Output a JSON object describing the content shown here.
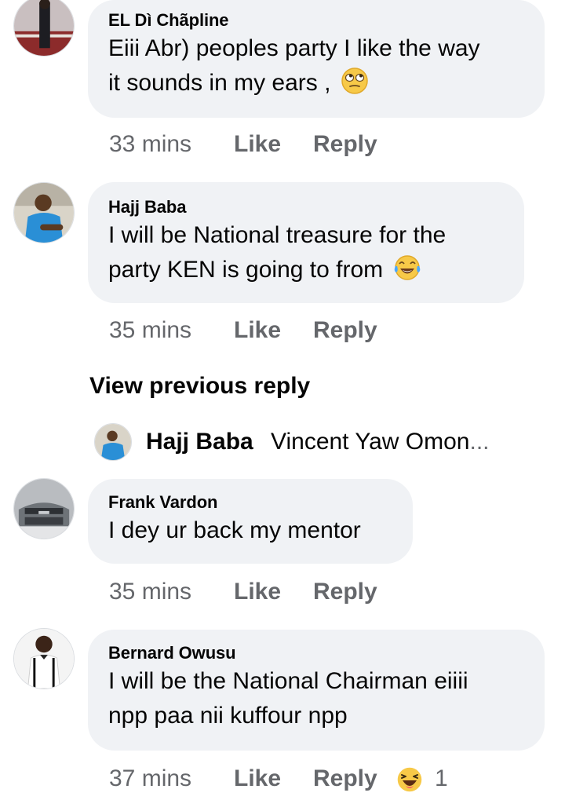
{
  "comments": [
    {
      "author": "EL Dì Chãpline",
      "lines": [
        "Eiii Abr) peoples party I like the way",
        "it sounds in my ears ,"
      ],
      "emoji": "rolling-eyes-emoji",
      "time": "33 mins",
      "like": "Like",
      "reply": "Reply"
    },
    {
      "author": "Hajj Baba",
      "lines": [
        "I will be National treasure for   the",
        "party KEN is going to from"
      ],
      "emoji": "tears-of-joy-emoji",
      "time": "35 mins",
      "like": "Like",
      "reply": "Reply"
    },
    {
      "author": "Frank Vardon",
      "lines": [
        "I dey ur back my mentor"
      ],
      "time": "35 mins",
      "like": "Like",
      "reply": "Reply"
    },
    {
      "author": "Bernard Owusu",
      "lines": [
        "I will be the National  Chairman eiiii",
        "npp paa nii  kuffour npp"
      ],
      "time": "37 mins",
      "like": "Like",
      "reply": "Reply",
      "reaction": {
        "icon": "haha-reaction-icon",
        "count": "1"
      }
    }
  ],
  "view_previous": "View previous reply",
  "reply_preview": {
    "author": "Hajj Baba",
    "text": "Vincent Yaw Omon",
    "ellipsis": "..."
  },
  "colors": {
    "bubble": "#f0f2f5",
    "meta_text": "#65676b",
    "text": "#050505",
    "emoji_yellow": "#f7c948"
  }
}
